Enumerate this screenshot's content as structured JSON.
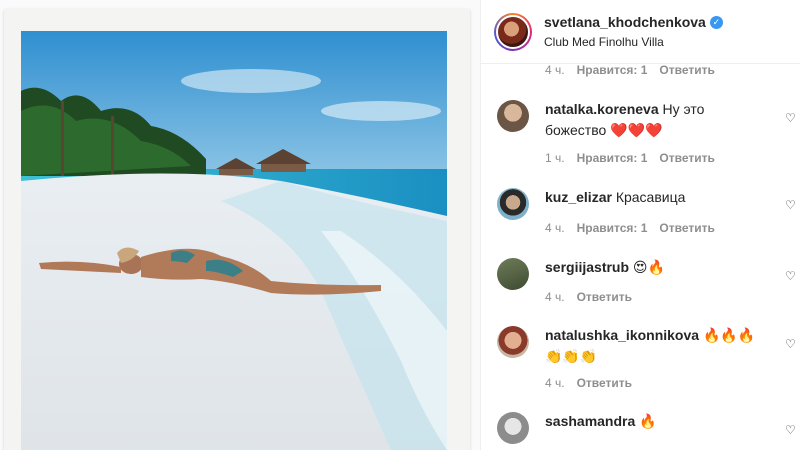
{
  "header": {
    "username": "svetlana_khodchenkova",
    "location": "Club Med Finolhu Villa"
  },
  "top_meta": {
    "time": "4 ч.",
    "likes": "Нравится: 1",
    "reply": "Ответить"
  },
  "comments": [
    {
      "username": "natalka.koreneva",
      "text": "Ну это божество ❤️❤️❤️",
      "time": "1 ч.",
      "likes": "Нравится: 1",
      "reply": "Ответить"
    },
    {
      "username": "kuz_elizar",
      "text": "Красавица",
      "time": "4 ч.",
      "likes": "Нравится: 1",
      "reply": "Ответить"
    },
    {
      "username": "sergiijastrub",
      "text": "😍🔥",
      "time": "4 ч.",
      "reply": "Ответить"
    },
    {
      "username": "natalushka_ikonnikova",
      "text": "🔥🔥🔥 👏👏👏",
      "time": "4 ч.",
      "reply": "Ответить"
    },
    {
      "username": "sashamandra",
      "text": "🔥"
    }
  ],
  "icons": {
    "verified": "verified-badge-icon",
    "more": "more-options-icon",
    "like": "heart-icon"
  }
}
